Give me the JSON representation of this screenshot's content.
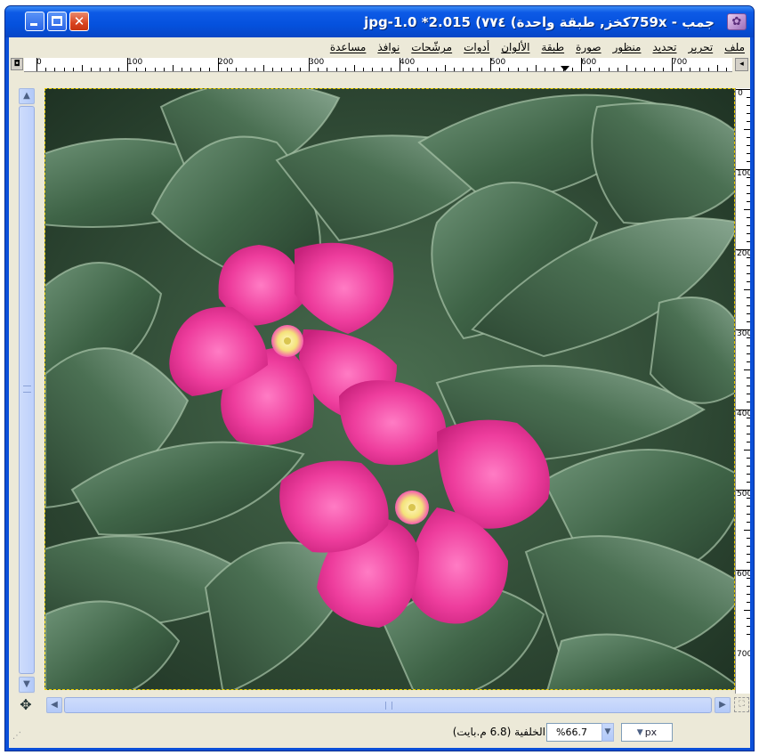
{
  "window": {
    "title": "*2 015.jpg-1.0 (٧٧٤) طبقة واحدة) 759xكخز, - جمب",
    "title_display": "جمب - 759xكخز, طبقة واحدة) ٧٧٤) 015.jpg-1.0 *2",
    "icon": "wilber-icon",
    "controls": {
      "minimize": "minimize-icon",
      "maximize": "maximize-icon",
      "close": "close-icon"
    }
  },
  "menubar": {
    "items": [
      "ملف",
      "تحرير",
      "تحديد",
      "منظور",
      "صورة",
      "طبقة",
      "الألوان",
      "أدوات",
      "مرشّحات",
      "نوافذ",
      "مساعدة"
    ]
  },
  "rulers": {
    "horizontal_labels": [
      "0",
      "100",
      "200",
      "300",
      "400",
      "500",
      "600",
      "700"
    ],
    "vertical_labels": [
      "0",
      "100",
      "200",
      "300",
      "400",
      "500",
      "600",
      "700"
    ]
  },
  "statusbar": {
    "unit": "px",
    "zoom": "%66.7",
    "layer_info": "الخلفية (6.8 م.بايت)"
  },
  "colors": {
    "titlebar": "#0551dd",
    "chrome": "#ece9d8",
    "selection_border": "#f0d000",
    "flower": "#ea3a98",
    "leaf": "#3d6246"
  }
}
